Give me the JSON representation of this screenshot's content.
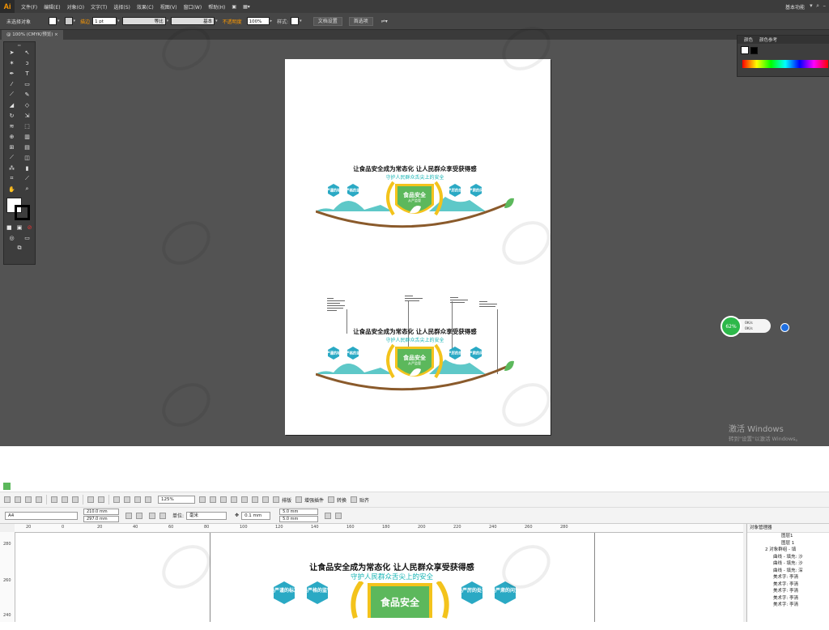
{
  "illustrator": {
    "logo": "Ai",
    "menus": [
      "文件(F)",
      "编辑(E)",
      "对象(O)",
      "文字(T)",
      "选择(S)",
      "效果(C)",
      "视图(V)",
      "窗口(W)",
      "帮助(H)"
    ],
    "workspace": "基本功能",
    "control_bar": {
      "selection_status": "未选择对象",
      "stroke_label": "描边",
      "stroke_weight": "1 pt",
      "profile": "等比",
      "brush": "基本",
      "opacity_label": "不透明度",
      "opacity_value": "100%",
      "style_label": "样式:",
      "doc_setup_button": "文档设置",
      "prefs_button": "首选项"
    },
    "doc_tab": "@ 100% (CMYK/预览)",
    "color_panel": {
      "tab_color": "颜色",
      "tab_color_guide": "颜色参考"
    },
    "accent_color": "#ff9a00"
  },
  "design": {
    "headline": "让食品安全成为常态化  让人民群众享受获得感",
    "subline": "守护人民群众舌尖上的安全",
    "hexagons_left": [
      "最严谨的标准",
      "最严格的监管"
    ],
    "hexagons_right": [
      "最严厉的处罚",
      "最严肃的问责"
    ],
    "shield_title": "食品安全",
    "shield_sub": "从严监管",
    "colors": {
      "teal": "#2aa9c4",
      "green": "#5cb85c",
      "wheat": "#f3c31c",
      "mountain": "#5ec8c8",
      "road": "#8a5a2b"
    }
  },
  "speed_widget": {
    "percent": "62%",
    "up": "0K/s",
    "down": "0K/s"
  },
  "windows_activation": {
    "title": "激活 Windows",
    "subtitle": "转到\"设置\"以激活 Windows。"
  },
  "coreldraw": {
    "toolbar1": {
      "zoom": "125%",
      "labels": [
        "排版",
        "增强插件",
        "转换",
        "贴齐"
      ]
    },
    "toolbar2": {
      "paper": "A4",
      "width": "210.0 mm",
      "height": "297.0 mm",
      "units_label": "单位:",
      "units": "毫米",
      "nudge": "0.1 mm",
      "dup_x": "5.0 mm",
      "dup_y": "5.0 mm"
    },
    "ruler_ticks": [
      "20",
      "0",
      "20",
      "40",
      "60",
      "80",
      "100",
      "120",
      "140",
      "160",
      "180",
      "200",
      "220",
      "240",
      "260",
      "280"
    ],
    "vruler_ticks": [
      "280",
      "260",
      "240"
    ],
    "object_manager": {
      "title": "对象管理器",
      "layer_a": "图层1",
      "layer_b": "图层 1",
      "group": "2 对象群组 - 填",
      "items": [
        "曲线 - 填充: 沙",
        "曲线 - 填充: 沙",
        "曲线 - 填充: 深",
        "美术字: 李清",
        "美术字: 李清",
        "美术字: 李清",
        "美术字: 李清",
        "美术字: 李清"
      ]
    }
  }
}
